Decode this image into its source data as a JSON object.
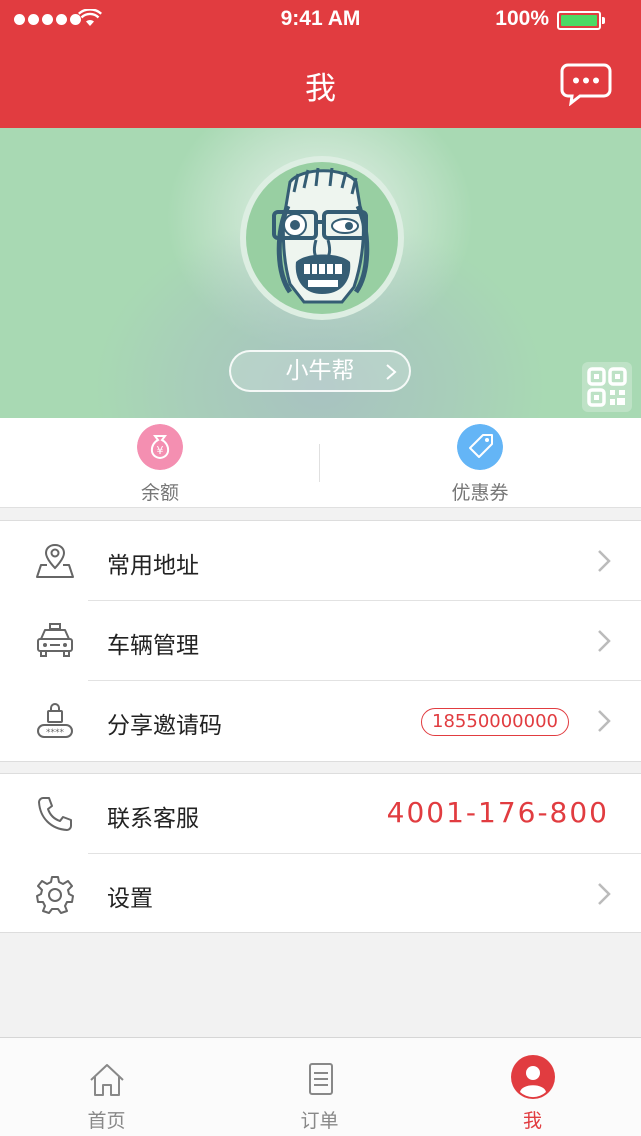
{
  "status_bar": {
    "time": "9:41 AM",
    "battery": "100%",
    "icons": [
      "signal-dots-icon",
      "wifi-icon",
      "battery-icon"
    ]
  },
  "nav": {
    "title": "我",
    "right_icon": "chat-bubble-icon"
  },
  "profile": {
    "username": "小牛帮",
    "avatar": "cartoon-face-avatar",
    "qr_icon": "qr-code-icon"
  },
  "wallet": {
    "items": [
      {
        "label": "余额",
        "icon": "money-bag-icon",
        "color": "#f48fb1"
      },
      {
        "label": "优惠券",
        "icon": "coupon-tag-icon",
        "color": "#64b5f6"
      }
    ]
  },
  "menu": {
    "group1": [
      {
        "label": "常用地址",
        "icon": "map-pin-icon"
      },
      {
        "label": "车辆管理",
        "icon": "car-icon"
      },
      {
        "label": "分享邀请码",
        "icon": "lock-code-icon",
        "badge": "18550000000"
      }
    ],
    "group2": [
      {
        "label": "联系客服",
        "icon": "phone-icon",
        "value": "4001-176-800"
      },
      {
        "label": "设置",
        "icon": "gear-icon"
      }
    ]
  },
  "tabbar": {
    "tabs": [
      {
        "label": "首页",
        "icon": "home-icon",
        "active": false
      },
      {
        "label": "订单",
        "icon": "order-list-icon",
        "active": false
      },
      {
        "label": "我",
        "icon": "user-icon",
        "active": true
      }
    ]
  },
  "colors": {
    "brand_red": "#e13c40",
    "banner_green": "#a8d9b3",
    "background": "#f2f2f2"
  }
}
